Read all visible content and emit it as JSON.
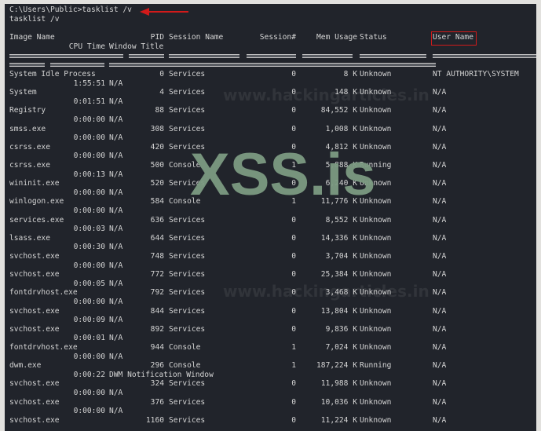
{
  "command_line": "C:\\Users\\Public>tasklist /v",
  "echo_line": "tasklist /v",
  "headers": {
    "image_name": "Image Name",
    "pid": "PID",
    "session_name": "Session Name",
    "session_num": "Session#",
    "mem_usage": "Mem Usage",
    "status": "Status",
    "user_name": "User Name",
    "cpu_time": "CPU Time",
    "window_title": "Window Title"
  },
  "watermarks": {
    "xss": "XSS.is",
    "site": "www.hackingarticles.in"
  },
  "colors": {
    "background": "#21242b",
    "text": "#d4d4d4",
    "highlight": "#d21a1a",
    "watermark": "#7c9a82"
  },
  "processes": [
    {
      "image": "System Idle Process",
      "pid": "0",
      "session": "Services",
      "num": "0",
      "mem": "8 K",
      "status": "Unknown",
      "user": "NT AUTHORITY\\SYSTEM",
      "cpu": "1:55:51",
      "title": "N/A"
    },
    {
      "image": "System",
      "pid": "4",
      "session": "Services",
      "num": "0",
      "mem": "148 K",
      "status": "Unknown",
      "user": "N/A",
      "cpu": "0:01:51",
      "title": "N/A"
    },
    {
      "image": "Registry",
      "pid": "88",
      "session": "Services",
      "num": "0",
      "mem": "84,552 K",
      "status": "Unknown",
      "user": "N/A",
      "cpu": "0:00:00",
      "title": "N/A"
    },
    {
      "image": "smss.exe",
      "pid": "308",
      "session": "Services",
      "num": "0",
      "mem": "1,008 K",
      "status": "Unknown",
      "user": "N/A",
      "cpu": "0:00:00",
      "title": "N/A"
    },
    {
      "image": "csrss.exe",
      "pid": "420",
      "session": "Services",
      "num": "0",
      "mem": "4,812 K",
      "status": "Unknown",
      "user": "N/A",
      "cpu": "0:00:00",
      "title": "N/A"
    },
    {
      "image": "csrss.exe",
      "pid": "500",
      "session": "Console",
      "num": "1",
      "mem": "5,888 K",
      "status": "Running",
      "user": "N/A",
      "cpu": "0:00:13",
      "title": "N/A"
    },
    {
      "image": "wininit.exe",
      "pid": "520",
      "session": "Services",
      "num": "0",
      "mem": "6,240 K",
      "status": "Unknown",
      "user": "N/A",
      "cpu": "0:00:00",
      "title": "N/A"
    },
    {
      "image": "winlogon.exe",
      "pid": "584",
      "session": "Console",
      "num": "1",
      "mem": "11,776 K",
      "status": "Unknown",
      "user": "N/A",
      "cpu": "0:00:00",
      "title": "N/A"
    },
    {
      "image": "services.exe",
      "pid": "636",
      "session": "Services",
      "num": "0",
      "mem": "8,552 K",
      "status": "Unknown",
      "user": "N/A",
      "cpu": "0:00:03",
      "title": "N/A"
    },
    {
      "image": "lsass.exe",
      "pid": "644",
      "session": "Services",
      "num": "0",
      "mem": "14,336 K",
      "status": "Unknown",
      "user": "N/A",
      "cpu": "0:00:30",
      "title": "N/A"
    },
    {
      "image": "svchost.exe",
      "pid": "748",
      "session": "Services",
      "num": "0",
      "mem": "3,704 K",
      "status": "Unknown",
      "user": "N/A",
      "cpu": "0:00:00",
      "title": "N/A"
    },
    {
      "image": "svchost.exe",
      "pid": "772",
      "session": "Services",
      "num": "0",
      "mem": "25,384 K",
      "status": "Unknown",
      "user": "N/A",
      "cpu": "0:00:05",
      "title": "N/A"
    },
    {
      "image": "fontdrvhost.exe",
      "pid": "792",
      "session": "Services",
      "num": "0",
      "mem": "3,468 K",
      "status": "Unknown",
      "user": "N/A",
      "cpu": "0:00:00",
      "title": "N/A"
    },
    {
      "image": "svchost.exe",
      "pid": "844",
      "session": "Services",
      "num": "0",
      "mem": "13,804 K",
      "status": "Unknown",
      "user": "N/A",
      "cpu": "0:00:09",
      "title": "N/A"
    },
    {
      "image": "svchost.exe",
      "pid": "892",
      "session": "Services",
      "num": "0",
      "mem": "9,836 K",
      "status": "Unknown",
      "user": "N/A",
      "cpu": "0:00:01",
      "title": "N/A"
    },
    {
      "image": "fontdrvhost.exe",
      "pid": "944",
      "session": "Console",
      "num": "1",
      "mem": "7,024 K",
      "status": "Unknown",
      "user": "N/A",
      "cpu": "0:00:00",
      "title": "N/A"
    },
    {
      "image": "dwm.exe",
      "pid": "296",
      "session": "Console",
      "num": "1",
      "mem": "187,224 K",
      "status": "Running",
      "user": "N/A",
      "cpu": "0:00:22",
      "title": "DWM Notification Window"
    },
    {
      "image": "svchost.exe",
      "pid": "324",
      "session": "Services",
      "num": "0",
      "mem": "11,988 K",
      "status": "Unknown",
      "user": "N/A",
      "cpu": "0:00:00",
      "title": "N/A"
    },
    {
      "image": "svchost.exe",
      "pid": "376",
      "session": "Services",
      "num": "0",
      "mem": "10,036 K",
      "status": "Unknown",
      "user": "N/A",
      "cpu": "0:00:00",
      "title": "N/A"
    },
    {
      "image": "svchost.exe",
      "pid": "1160",
      "session": "Services",
      "num": "0",
      "mem": "11,224 K",
      "status": "Unknown",
      "user": "N/A",
      "cpu": "",
      "title": ""
    }
  ]
}
